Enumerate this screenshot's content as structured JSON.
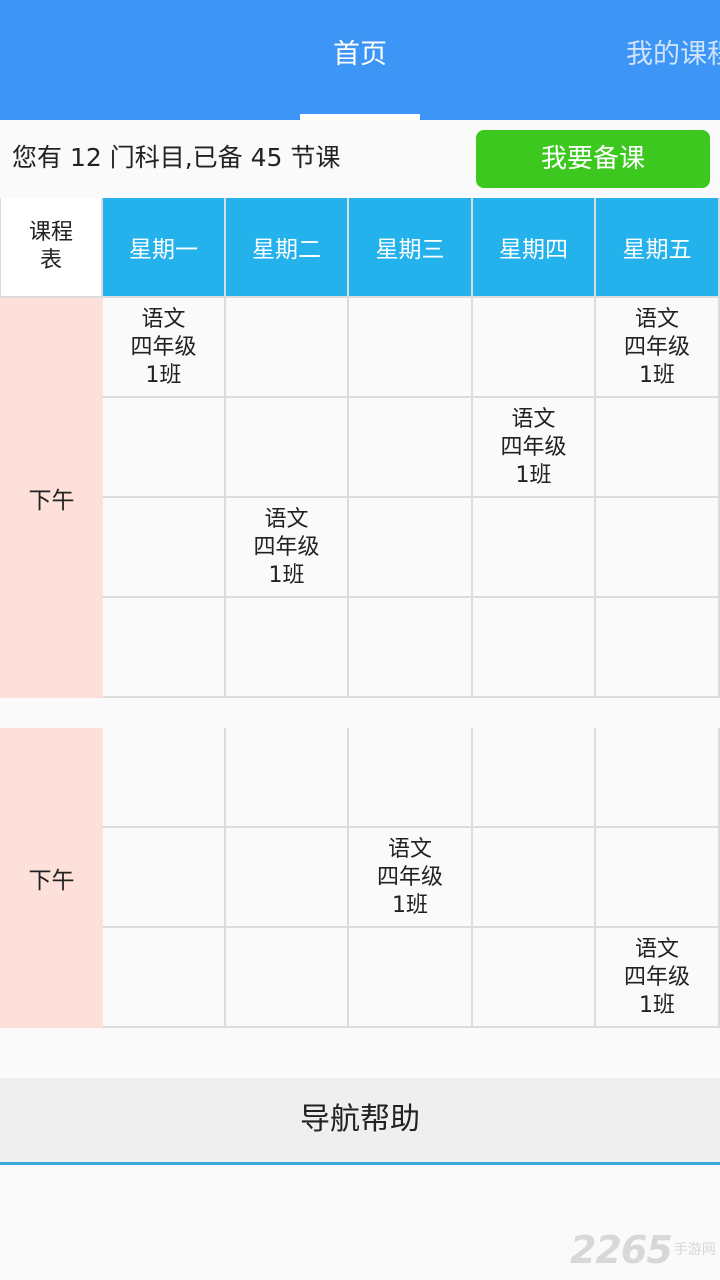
{
  "tabs": {
    "home": "首页",
    "my_courses": "我的课程"
  },
  "summary": {
    "text": "您有 12 门科目,已备 45 节课",
    "prep_button": "我要备课"
  },
  "timetable": {
    "corner_label": "课程\n表",
    "days": [
      "星期一",
      "星期二",
      "星期三",
      "星期四",
      "星期五"
    ],
    "blocks": [
      {
        "period_label": "下午",
        "rows": [
          [
            {
              "subject": "语文",
              "grade": "四年级",
              "class": "1班"
            },
            null,
            null,
            null,
            {
              "subject": "语文",
              "grade": "四年级",
              "class": "1班"
            }
          ],
          [
            null,
            null,
            null,
            {
              "subject": "语文",
              "grade": "四年级",
              "class": "1班"
            },
            null
          ],
          [
            null,
            {
              "subject": "语文",
              "grade": "四年级",
              "class": "1班"
            },
            null,
            null,
            null
          ],
          [
            null,
            null,
            null,
            null,
            null
          ]
        ]
      },
      {
        "period_label": "下午",
        "rows": [
          [
            null,
            null,
            null,
            null,
            null
          ],
          [
            null,
            null,
            {
              "subject": "语文",
              "grade": "四年级",
              "class": "1班"
            },
            null,
            null
          ],
          [
            null,
            null,
            null,
            null,
            {
              "subject": "语文",
              "grade": "四年级",
              "class": "1班"
            }
          ]
        ]
      }
    ]
  },
  "nav_help": "导航帮助",
  "watermark": {
    "brand": "2265",
    "sub": "手游网"
  },
  "colors": {
    "topbar": "#3d96f5",
    "day_header": "#23b2ec",
    "period_bg": "#fde0da",
    "prep_button": "#3cc81e"
  }
}
